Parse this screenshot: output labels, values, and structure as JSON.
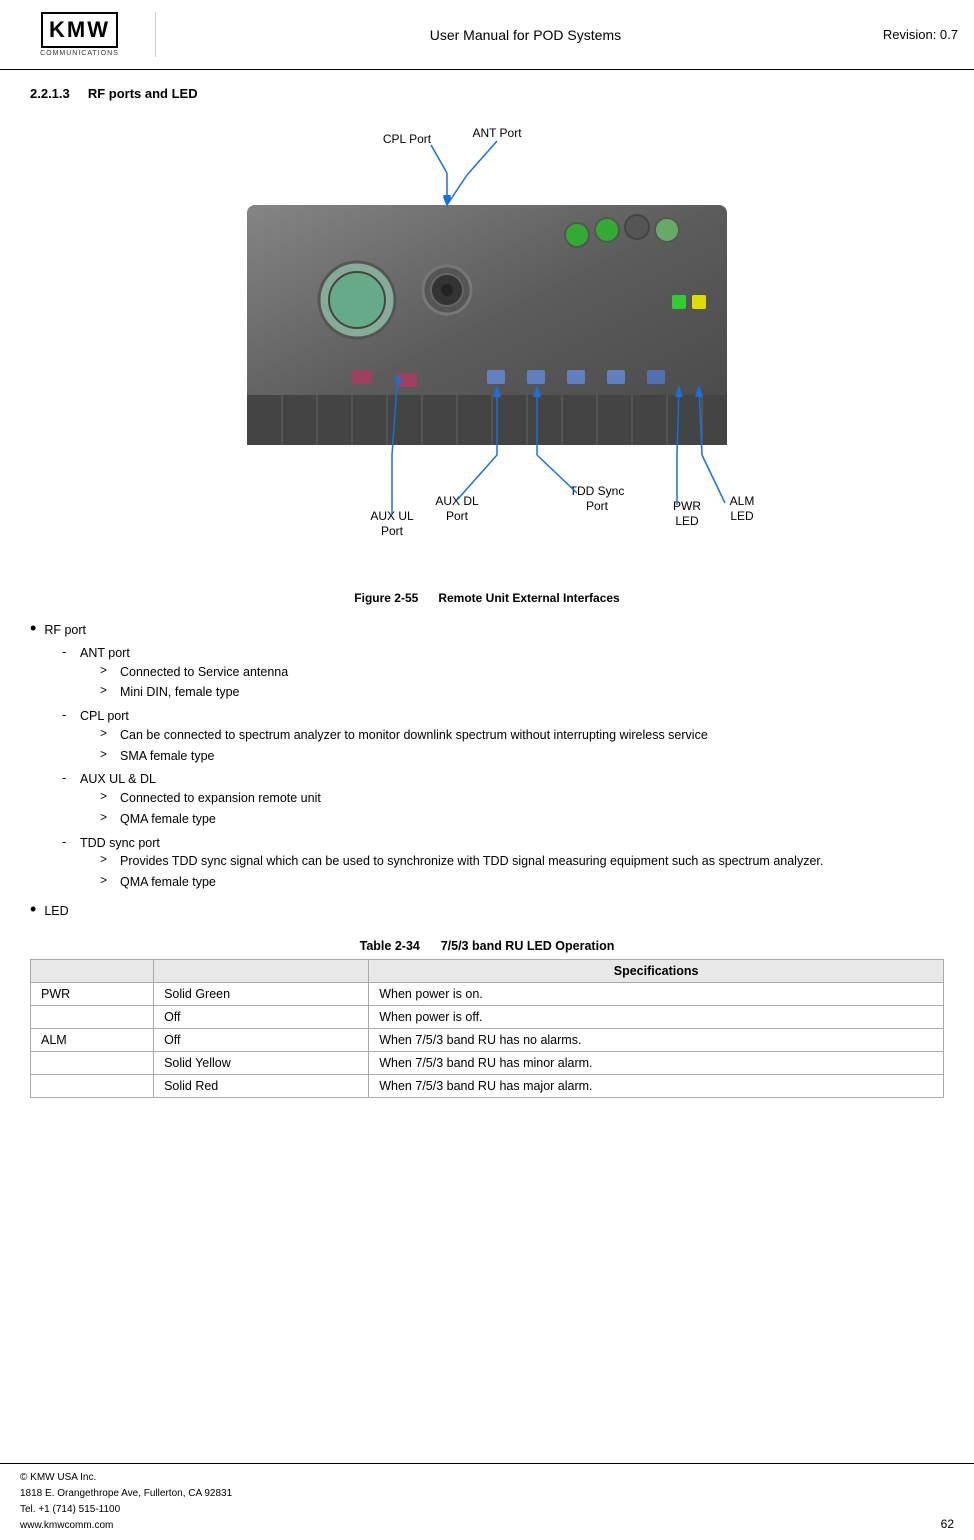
{
  "header": {
    "title": "User Manual for POD Systems",
    "revision": "Revision: 0.7",
    "logo_main": "KMW",
    "logo_sub": "COMMUNICATIONS"
  },
  "section": {
    "number": "2.2.1.3",
    "title": "RF ports and LED"
  },
  "diagram": {
    "labels": {
      "cpl_port": "CPL Port",
      "ant_port": "ANT Port",
      "aux_ul_port": "AUX UL\nPort",
      "aux_dl_port": "AUX DL\nPort",
      "tdd_sync_port": "TDD Sync\nPort",
      "pwr_led": "PWR\nLED",
      "alm_led": "ALM\nLED"
    }
  },
  "figure": {
    "number": "Figure 2-55",
    "title": "Remote Unit External Interfaces"
  },
  "bullets": [
    {
      "label": "RF port",
      "sub_items": [
        {
          "label": "ANT port",
          "items": [
            "Connected to Service antenna",
            "Mini DIN, female type"
          ]
        },
        {
          "label": "CPL port",
          "items": [
            "Can be connected to spectrum analyzer to monitor downlink spectrum without interrupting wireless service",
            "SMA female type"
          ]
        },
        {
          "label": "AUX UL & DL",
          "items": [
            "Connected to expansion remote unit",
            "QMA female type"
          ]
        },
        {
          "label": "TDD sync port",
          "items": [
            "Provides TDD sync signal which can be used to synchronize with TDD signal measuring equipment such as spectrum analyzer.",
            "QMA female type"
          ]
        }
      ]
    },
    {
      "label": "LED",
      "sub_items": []
    }
  ],
  "table": {
    "caption_num": "Table 2-34",
    "caption_title": "7/5/3 band RU LED Operation",
    "header_col1": "",
    "header_col2": "",
    "header_col3": "Specifications",
    "rows": [
      {
        "col1": "PWR",
        "col2": "Solid Green",
        "col3": "When power is on."
      },
      {
        "col1": "",
        "col2": "Off",
        "col3": "When power is off."
      },
      {
        "col1": "ALM",
        "col2": "Off",
        "col3": "When 7/5/3 band RU has no alarms."
      },
      {
        "col1": "",
        "col2": "Solid Yellow",
        "col3": "When 7/5/3 band RU has minor alarm."
      },
      {
        "col1": "",
        "col2": "Solid Red",
        "col3": "When 7/5/3 band RU has major alarm."
      }
    ]
  },
  "footer": {
    "company": "© KMW USA Inc.",
    "address": "1818 E. Orangethrope Ave, Fullerton, CA 92831",
    "tel": "Tel. +1 (714) 515-1100",
    "website": "www.kmwcomm.com",
    "page_number": "62"
  }
}
